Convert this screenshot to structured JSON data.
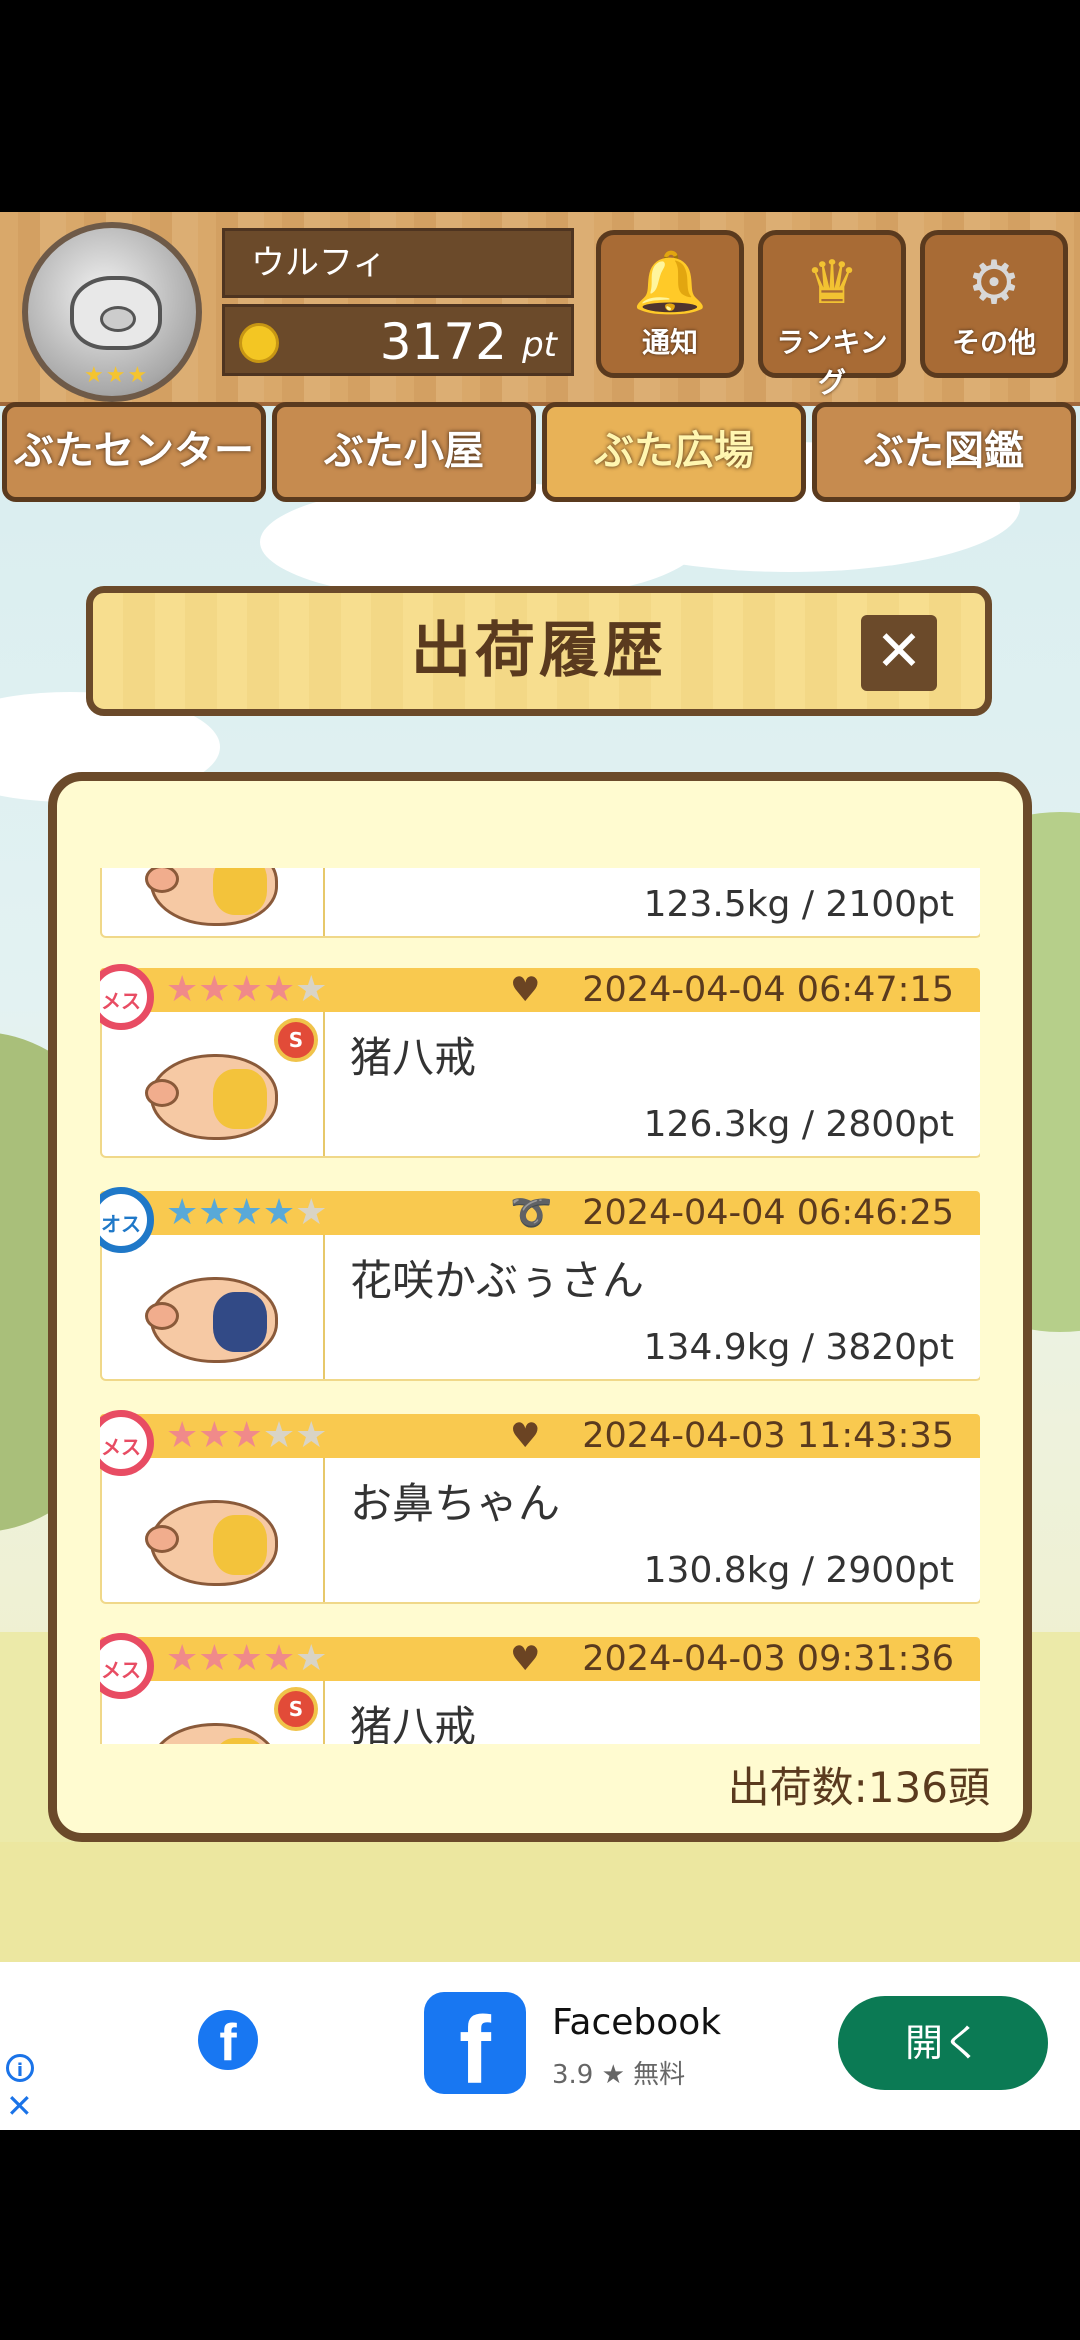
{
  "header": {
    "user_name": "ウルフィ",
    "points_value": "3172",
    "points_unit": "pt",
    "buttons": [
      {
        "label": "通知",
        "icon": "bell-icon"
      },
      {
        "label": "ランキング",
        "icon": "crown-icon"
      },
      {
        "label": "その他",
        "icon": "gear-icon"
      }
    ]
  },
  "tabs": [
    "ぶたセンター",
    "ぶた小屋",
    "ぶた広場",
    "ぶた図鑑"
  ],
  "active_tab": "ぶた広場",
  "dialog": {
    "title": "出荷履歴",
    "close_label": "✕",
    "count_label": "出荷数:136頭",
    "entries": [
      {
        "name": "",
        "weight_pt": "123.5kg / 2100pt",
        "date": "",
        "sex": "",
        "stars": 0
      },
      {
        "sex_label": "メス",
        "sex": "female",
        "stars": 4,
        "mood": "heart-icon",
        "date": "2024-04-04 06:47:15",
        "name": "猪八戒",
        "weight_pt": "126.3kg / 2800pt",
        "badge": "S"
      },
      {
        "sex_label": "オス",
        "sex": "male",
        "stars": 4,
        "mood": "lasso-icon",
        "date": "2024-04-04 06:46:25",
        "name": "花咲かぶぅさん",
        "weight_pt": "134.9kg / 3820pt",
        "badge": ""
      },
      {
        "sex_label": "メス",
        "sex": "female",
        "stars": 3,
        "mood": "heart-icon",
        "date": "2024-04-03 11:43:35",
        "name": "お鼻ちゃん",
        "weight_pt": "130.8kg / 2900pt",
        "badge": ""
      },
      {
        "sex_label": "メス",
        "sex": "female",
        "stars": 4,
        "mood": "heart-icon",
        "date": "2024-04-03 09:31:36",
        "name": "猪八戒",
        "weight_pt": "",
        "badge": "S"
      }
    ]
  },
  "ad": {
    "title": "Facebook",
    "rating": "3.9 ★  無料",
    "button_label": "開く",
    "info_icon": "i",
    "close_icon": "✕"
  }
}
